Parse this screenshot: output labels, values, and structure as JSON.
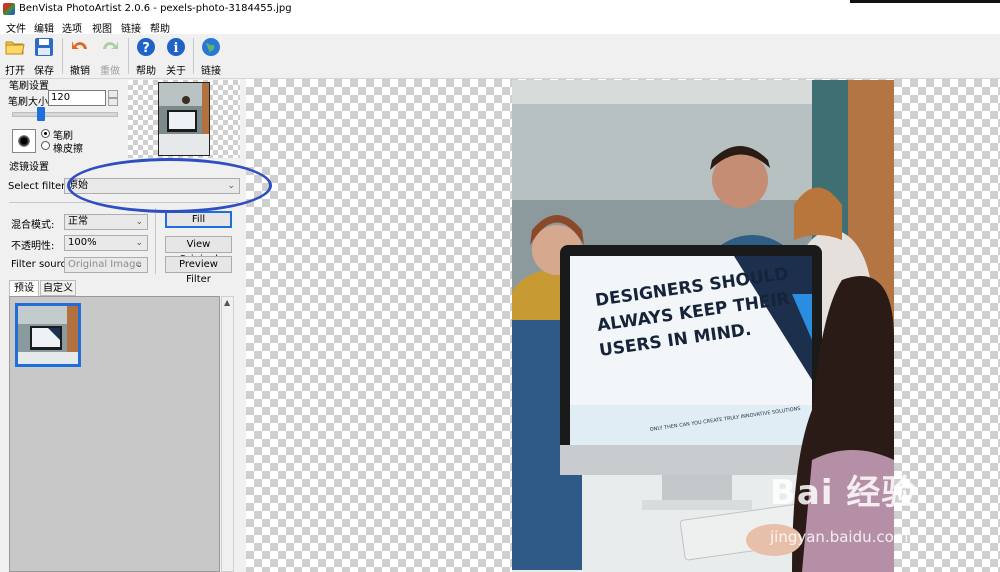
{
  "window": {
    "title": "BenVista PhotoArtist 2.0.6 - pexels-photo-3184455.jpg"
  },
  "menu": [
    "文件",
    "编辑",
    "选项",
    "视图",
    "链接",
    "帮助"
  ],
  "toolbar": {
    "open": "打开",
    "save": "保存",
    "undo": "撤销",
    "redo": "重做",
    "help": "帮助",
    "about": "关于",
    "link": "链接"
  },
  "brush": {
    "group_label": "笔刷设置",
    "size_label": "笔刷大小:",
    "size_value": "120",
    "size_fraction": 0.28,
    "mode_brush": "笔刷",
    "mode_eraser": "橡皮擦",
    "selected_mode": "笔刷"
  },
  "filter": {
    "group_label": "滤镜设置",
    "select_label": "Select filter:",
    "selected_filter": "原始",
    "blend_label": "混合模式:",
    "blend_value": "正常",
    "opacity_label": "不透明性:",
    "opacity_value": "100%",
    "source_label": "Filter source:",
    "source_value": "Original Image",
    "fill_button": "Fill",
    "view_original_button": "View Original",
    "preview_filter_button": "Preview Filter"
  },
  "tabs": {
    "presets": "预设",
    "custom": "自定义"
  },
  "photo": {
    "screen_headline_1": "DESIGNERS SHOULD",
    "screen_headline_2": "ALWAYS KEEP THEIR",
    "screen_headline_3": "USERS IN MIND.",
    "screen_tagline": "ONLY THEN CAN YOU CREATE TRULY INNOVATIVE SOLUTIONS"
  },
  "watermark": {
    "main": "Bai 经验",
    "sub": "jingyan.baidu.com"
  },
  "colors": {
    "accent": "#1e6fd9",
    "highlight_ellipse": "#2f4fc0",
    "checker": "#cfcfcf"
  }
}
